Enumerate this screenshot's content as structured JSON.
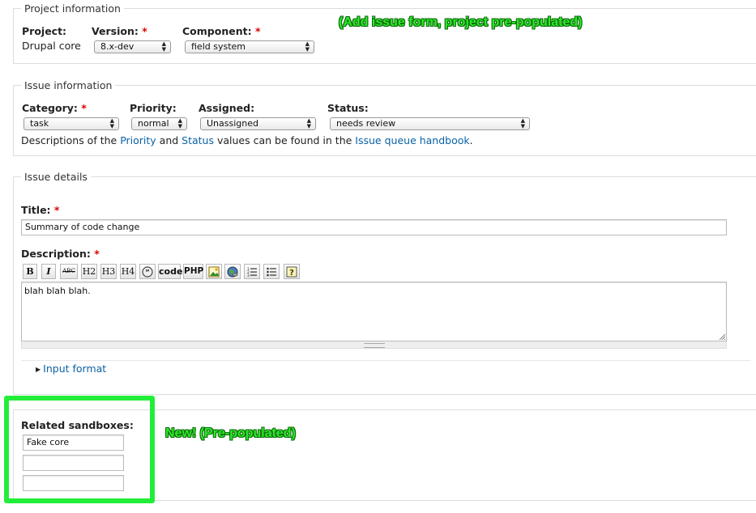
{
  "annotations": {
    "form_note": "(Add issue form, project pre-populated)",
    "new_note": "New! (Pre-populated)",
    "highlight_color": "#22ee3a"
  },
  "project_info": {
    "legend": "Project information",
    "project_label": "Project:",
    "project_value": "Drupal core",
    "version_label": "Version:",
    "version_value": "8.x-dev",
    "component_label": "Component:",
    "component_value": "field system",
    "required_mark": "*"
  },
  "issue_info": {
    "legend": "Issue information",
    "category_label": "Category:",
    "category_value": "task",
    "priority_label": "Priority:",
    "priority_value": "normal",
    "assigned_label": "Assigned:",
    "assigned_value": "Unassigned",
    "status_label": "Status:",
    "status_value": "needs review",
    "help": {
      "prefix": "Descriptions of the ",
      "priority_link": "Priority",
      "and": " and ",
      "status_link": "Status",
      "middle": " values can be found in the ",
      "handbook_link": "Issue queue handbook",
      "suffix": "."
    }
  },
  "issue_details": {
    "legend": "Issue details",
    "title_label": "Title:",
    "title_value": "Summary of code change",
    "description_label": "Description:",
    "description_value": "blah blah blah.",
    "toolbar": {
      "bold": "B",
      "italic": "I",
      "strike": "ABC",
      "h2": "H2",
      "h3": "H3",
      "h4": "H4",
      "quote_icon": "quote-icon",
      "code": "code",
      "php": "PHP",
      "image_icon": "image-icon",
      "link_icon": "link-globe-icon",
      "ol_icon": "ordered-list-icon",
      "ul_icon": "unordered-list-icon",
      "help_icon": "help-icon"
    },
    "input_format": "Input format"
  },
  "sandboxes": {
    "label": "Related sandboxes:",
    "values": [
      "Fake core",
      "",
      ""
    ]
  }
}
